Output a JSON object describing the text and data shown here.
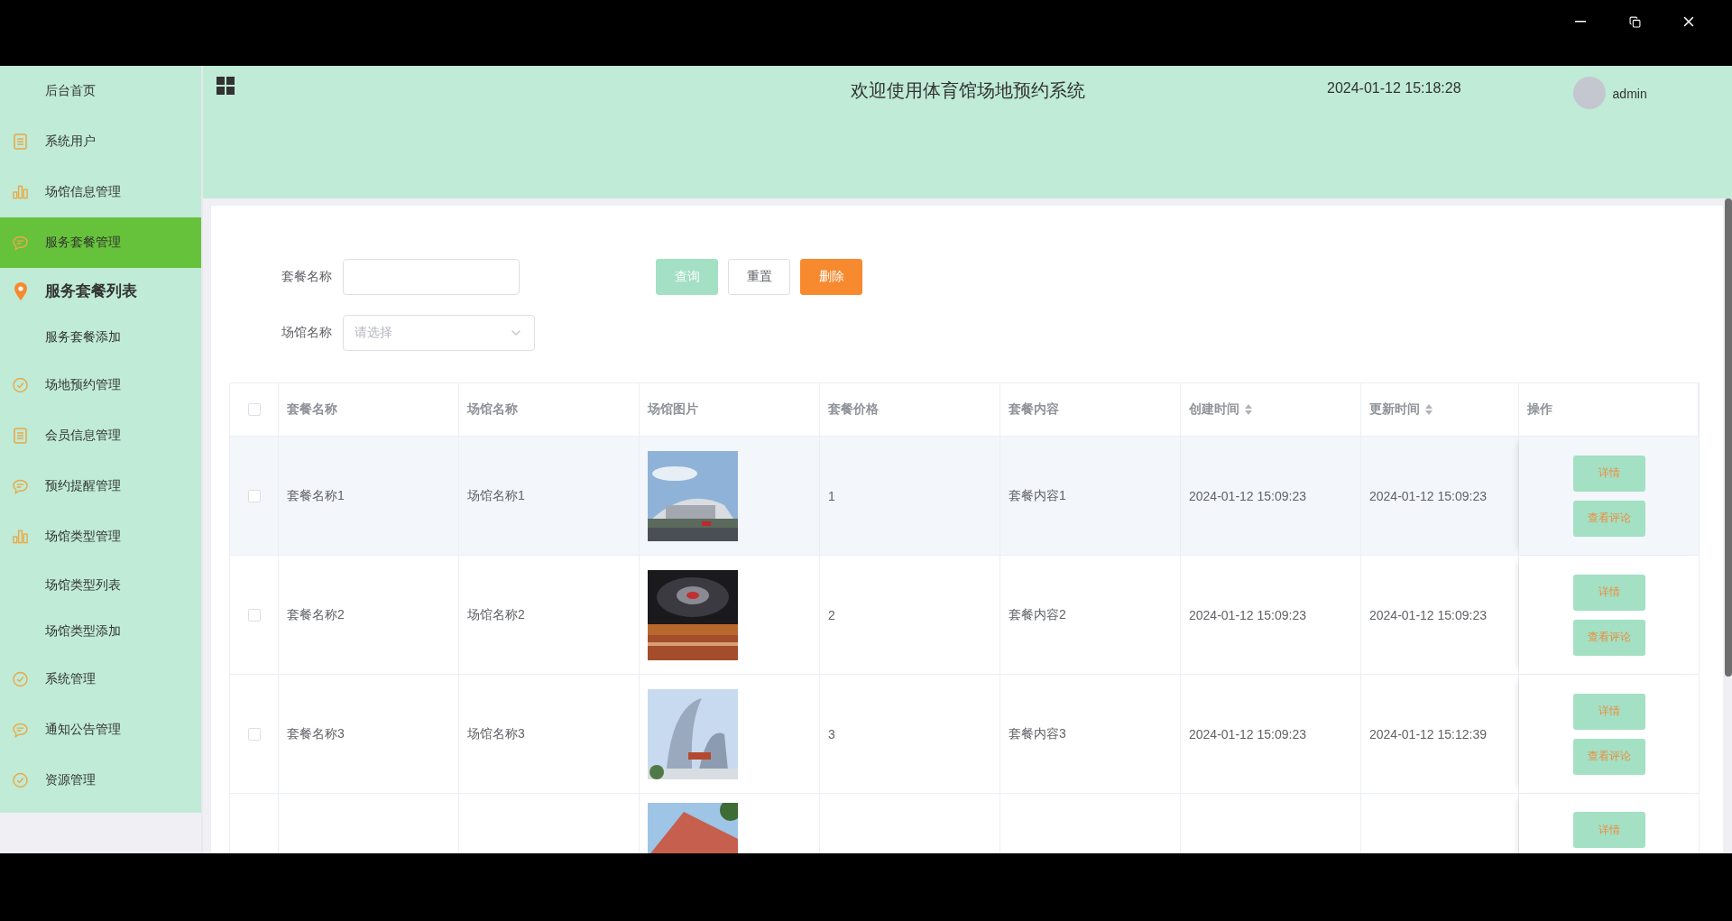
{
  "sidebar": {
    "items": [
      {
        "label": "后台首页",
        "selected": false
      },
      {
        "label": "系统用户",
        "selected": false
      },
      {
        "label": "场馆信息管理",
        "selected": false
      },
      {
        "label": "服务套餐管理",
        "selected": true,
        "children": [
          {
            "label": "服务套餐列表",
            "selected": true
          },
          {
            "label": "服务套餐添加",
            "selected": false
          }
        ]
      },
      {
        "label": "场地预约管理",
        "selected": false
      },
      {
        "label": "会员信息管理",
        "selected": false
      },
      {
        "label": "预约提醒管理",
        "selected": false
      },
      {
        "label": "场馆类型管理",
        "selected": false,
        "children": [
          {
            "label": "场馆类型列表",
            "selected": false
          },
          {
            "label": "场馆类型添加",
            "selected": false
          }
        ]
      },
      {
        "label": "系统管理",
        "selected": false
      },
      {
        "label": "通知公告管理",
        "selected": false
      },
      {
        "label": "资源管理",
        "selected": false
      }
    ]
  },
  "header": {
    "title": "欢迎使用体育馆场地预约系统",
    "datetime": "2024-01-12 15:18:28",
    "user": "admin"
  },
  "filters": [
    {
      "kind": "text",
      "label": "套餐名称"
    },
    {
      "kind": "select",
      "label": "场馆名称",
      "placeholder": "请选择"
    }
  ],
  "buttons": [
    {
      "kind": "query",
      "label": "查询"
    },
    {
      "kind": "reset",
      "label": "重置"
    },
    {
      "kind": "delete",
      "label": "删除"
    }
  ],
  "table": {
    "select_all": {
      "checked": false
    },
    "columns": [
      {
        "label": "套餐名称",
        "sortable": false
      },
      {
        "label": "场馆名称",
        "sortable": false
      },
      {
        "label": "场馆图片",
        "sortable": false
      },
      {
        "label": "套餐价格",
        "sortable": false
      },
      {
        "label": "套餐内容",
        "sortable": false
      },
      {
        "label": "创建时间",
        "sortable": true
      },
      {
        "label": "更新时间",
        "sortable": true
      },
      {
        "label": "操作",
        "sortable": false
      }
    ],
    "rows": [
      {
        "kind": "full",
        "checked": false,
        "hovered": true,
        "cells": [
          "套餐名称1",
          "场馆名称1",
          {
            "kind": "picture"
          },
          "1",
          "套餐内容1",
          "2024-01-12 15:09:23",
          "2024-01-12 15:09:23"
        ],
        "actions": [
          "详情",
          "查看评论"
        ]
      },
      {
        "kind": "full",
        "checked": false,
        "hovered": false,
        "cells": [
          "套餐名称2",
          "场馆名称2",
          {
            "kind": "picture"
          },
          "2",
          "套餐内容2",
          "2024-01-12 15:09:23",
          "2024-01-12 15:09:23"
        ],
        "actions": [
          "详情",
          "查看评论"
        ]
      },
      {
        "kind": "full",
        "checked": false,
        "hovered": false,
        "cells": [
          "套餐名称3",
          "场馆名称3",
          {
            "kind": "picture"
          },
          "3",
          "套餐内容3",
          "2024-01-12 15:09:23",
          "2024-01-12 15:12:39"
        ],
        "actions": [
          "详情",
          "查看评论"
        ]
      },
      {
        "kind": "cut",
        "hovered": false,
        "cells": [
          {
            "kind": "picture"
          }
        ],
        "actions": [
          "详情"
        ]
      }
    ]
  }
}
